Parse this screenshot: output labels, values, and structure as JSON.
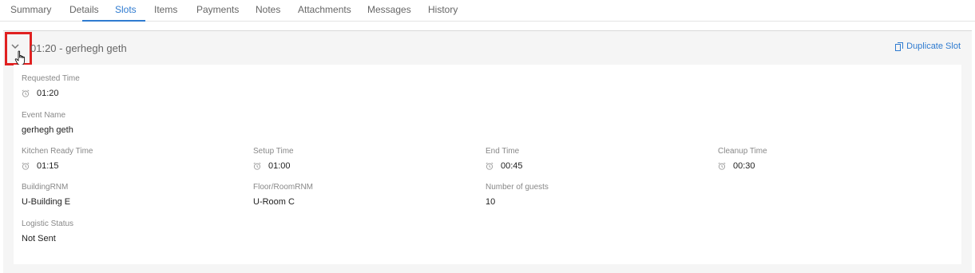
{
  "tabs": [
    {
      "label": "Summary"
    },
    {
      "label": "Details"
    },
    {
      "label": "Slots",
      "active": true
    },
    {
      "label": "Items"
    },
    {
      "label": "Payments"
    },
    {
      "label": "Notes"
    },
    {
      "label": "Attachments"
    },
    {
      "label": "Messages"
    },
    {
      "label": "History"
    }
  ],
  "slot": {
    "title": "01:20 - gerhegh geth",
    "duplicate_label": "Duplicate Slot",
    "expanded": true
  },
  "fields": {
    "requested_time": {
      "label": "Requested Time",
      "value": "01:20"
    },
    "event_name": {
      "label": "Event Name",
      "value": "gerhegh geth"
    },
    "kitchen_ready_time": {
      "label": "Kitchen Ready Time",
      "value": "01:15"
    },
    "setup_time": {
      "label": "Setup Time",
      "value": "01:00"
    },
    "end_time": {
      "label": "End Time",
      "value": "00:45"
    },
    "cleanup_time": {
      "label": "Cleanup Time",
      "value": "00:30"
    },
    "building": {
      "label": "BuildingRNM",
      "value": "U-Building E"
    },
    "floor_room": {
      "label": "Floor/RoomRNM",
      "value": "U-Room C"
    },
    "guests": {
      "label": "Number of guests",
      "value": "10"
    },
    "logistic_status": {
      "label": "Logistic Status",
      "value": "Not Sent"
    }
  },
  "colors": {
    "accent": "#2f7bd0",
    "highlight": "#e02020"
  },
  "icons": {
    "time": "alarm-clock-icon",
    "expand": "chevron-down-icon",
    "duplicate": "copy-icon",
    "cursor": "hand-pointer-icon"
  }
}
